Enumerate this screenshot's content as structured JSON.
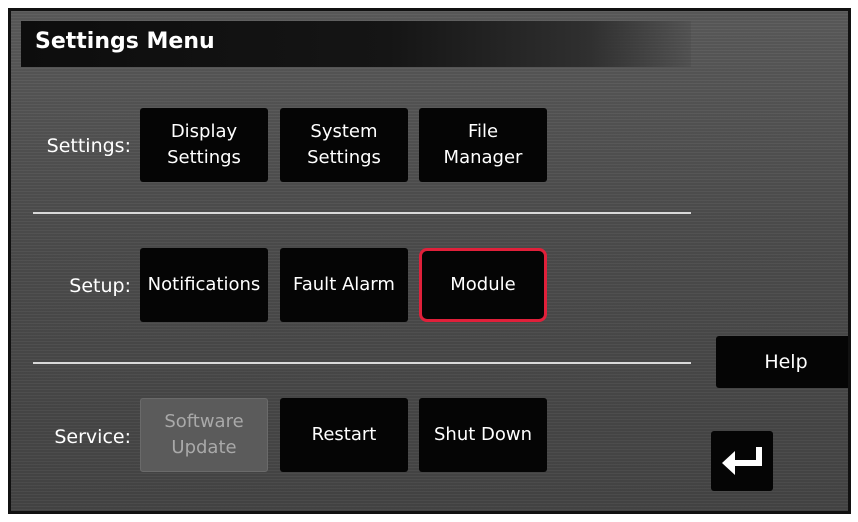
{
  "title": "Settings Menu",
  "rows": [
    {
      "label": "Settings:",
      "buttons": [
        {
          "label": "Display\nSettings",
          "state": "normal"
        },
        {
          "label": "System\nSettings",
          "state": "normal"
        },
        {
          "label": "File\nManager",
          "state": "normal"
        }
      ]
    },
    {
      "label": "Setup:",
      "buttons": [
        {
          "label": "Notifications",
          "state": "normal"
        },
        {
          "label": "Fault Alarm",
          "state": "normal"
        },
        {
          "label": "Module",
          "state": "selected"
        }
      ]
    },
    {
      "label": "Service:",
      "buttons": [
        {
          "label": "Software\nUpdate",
          "state": "disabled"
        },
        {
          "label": "Restart",
          "state": "normal"
        },
        {
          "label": "Shut Down",
          "state": "normal"
        }
      ]
    }
  ],
  "side": {
    "help_label": "Help",
    "back_icon": "return-arrow-icon"
  },
  "colors": {
    "selected_border": "#e0203a",
    "button_bg": "#050505",
    "disabled_bg": "#5b5b5b"
  }
}
